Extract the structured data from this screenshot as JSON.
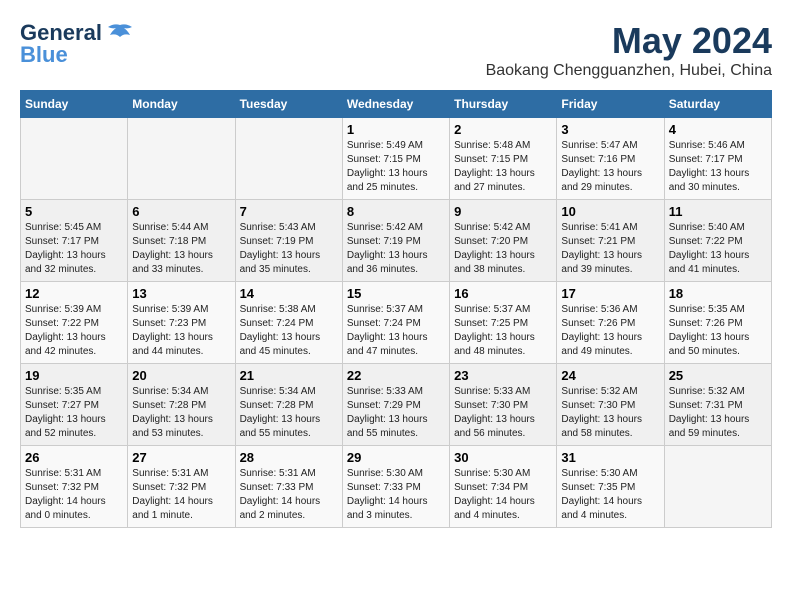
{
  "header": {
    "logo_general": "General",
    "logo_blue": "Blue",
    "month_title": "May 2024",
    "location": "Baokang Chengguanzhen, Hubei, China"
  },
  "days_of_week": [
    "Sunday",
    "Monday",
    "Tuesday",
    "Wednesday",
    "Thursday",
    "Friday",
    "Saturday"
  ],
  "weeks": [
    [
      {
        "day": "",
        "empty": true
      },
      {
        "day": "",
        "empty": true
      },
      {
        "day": "",
        "empty": true
      },
      {
        "day": "1",
        "sunrise": "5:49 AM",
        "sunset": "7:15 PM",
        "daylight": "13 hours and 25 minutes."
      },
      {
        "day": "2",
        "sunrise": "5:48 AM",
        "sunset": "7:15 PM",
        "daylight": "13 hours and 27 minutes."
      },
      {
        "day": "3",
        "sunrise": "5:47 AM",
        "sunset": "7:16 PM",
        "daylight": "13 hours and 29 minutes."
      },
      {
        "day": "4",
        "sunrise": "5:46 AM",
        "sunset": "7:17 PM",
        "daylight": "13 hours and 30 minutes."
      }
    ],
    [
      {
        "day": "5",
        "sunrise": "5:45 AM",
        "sunset": "7:17 PM",
        "daylight": "13 hours and 32 minutes."
      },
      {
        "day": "6",
        "sunrise": "5:44 AM",
        "sunset": "7:18 PM",
        "daylight": "13 hours and 33 minutes."
      },
      {
        "day": "7",
        "sunrise": "5:43 AM",
        "sunset": "7:19 PM",
        "daylight": "13 hours and 35 minutes."
      },
      {
        "day": "8",
        "sunrise": "5:42 AM",
        "sunset": "7:19 PM",
        "daylight": "13 hours and 36 minutes."
      },
      {
        "day": "9",
        "sunrise": "5:42 AM",
        "sunset": "7:20 PM",
        "daylight": "13 hours and 38 minutes."
      },
      {
        "day": "10",
        "sunrise": "5:41 AM",
        "sunset": "7:21 PM",
        "daylight": "13 hours and 39 minutes."
      },
      {
        "day": "11",
        "sunrise": "5:40 AM",
        "sunset": "7:22 PM",
        "daylight": "13 hours and 41 minutes."
      }
    ],
    [
      {
        "day": "12",
        "sunrise": "5:39 AM",
        "sunset": "7:22 PM",
        "daylight": "13 hours and 42 minutes."
      },
      {
        "day": "13",
        "sunrise": "5:39 AM",
        "sunset": "7:23 PM",
        "daylight": "13 hours and 44 minutes."
      },
      {
        "day": "14",
        "sunrise": "5:38 AM",
        "sunset": "7:24 PM",
        "daylight": "13 hours and 45 minutes."
      },
      {
        "day": "15",
        "sunrise": "5:37 AM",
        "sunset": "7:24 PM",
        "daylight": "13 hours and 47 minutes."
      },
      {
        "day": "16",
        "sunrise": "5:37 AM",
        "sunset": "7:25 PM",
        "daylight": "13 hours and 48 minutes."
      },
      {
        "day": "17",
        "sunrise": "5:36 AM",
        "sunset": "7:26 PM",
        "daylight": "13 hours and 49 minutes."
      },
      {
        "day": "18",
        "sunrise": "5:35 AM",
        "sunset": "7:26 PM",
        "daylight": "13 hours and 50 minutes."
      }
    ],
    [
      {
        "day": "19",
        "sunrise": "5:35 AM",
        "sunset": "7:27 PM",
        "daylight": "13 hours and 52 minutes."
      },
      {
        "day": "20",
        "sunrise": "5:34 AM",
        "sunset": "7:28 PM",
        "daylight": "13 hours and 53 minutes."
      },
      {
        "day": "21",
        "sunrise": "5:34 AM",
        "sunset": "7:28 PM",
        "daylight": "13 hours and 55 minutes."
      },
      {
        "day": "22",
        "sunrise": "5:33 AM",
        "sunset": "7:29 PM",
        "daylight": "13 hours and 55 minutes."
      },
      {
        "day": "23",
        "sunrise": "5:33 AM",
        "sunset": "7:30 PM",
        "daylight": "13 hours and 56 minutes."
      },
      {
        "day": "24",
        "sunrise": "5:32 AM",
        "sunset": "7:30 PM",
        "daylight": "13 hours and 58 minutes."
      },
      {
        "day": "25",
        "sunrise": "5:32 AM",
        "sunset": "7:31 PM",
        "daylight": "13 hours and 59 minutes."
      }
    ],
    [
      {
        "day": "26",
        "sunrise": "5:31 AM",
        "sunset": "7:32 PM",
        "daylight": "14 hours and 0 minutes."
      },
      {
        "day": "27",
        "sunrise": "5:31 AM",
        "sunset": "7:32 PM",
        "daylight": "14 hours and 1 minute."
      },
      {
        "day": "28",
        "sunrise": "5:31 AM",
        "sunset": "7:33 PM",
        "daylight": "14 hours and 2 minutes."
      },
      {
        "day": "29",
        "sunrise": "5:30 AM",
        "sunset": "7:33 PM",
        "daylight": "14 hours and 3 minutes."
      },
      {
        "day": "30",
        "sunrise": "5:30 AM",
        "sunset": "7:34 PM",
        "daylight": "14 hours and 4 minutes."
      },
      {
        "day": "31",
        "sunrise": "5:30 AM",
        "sunset": "7:35 PM",
        "daylight": "14 hours and 4 minutes."
      },
      {
        "day": "",
        "empty": true
      }
    ]
  ]
}
